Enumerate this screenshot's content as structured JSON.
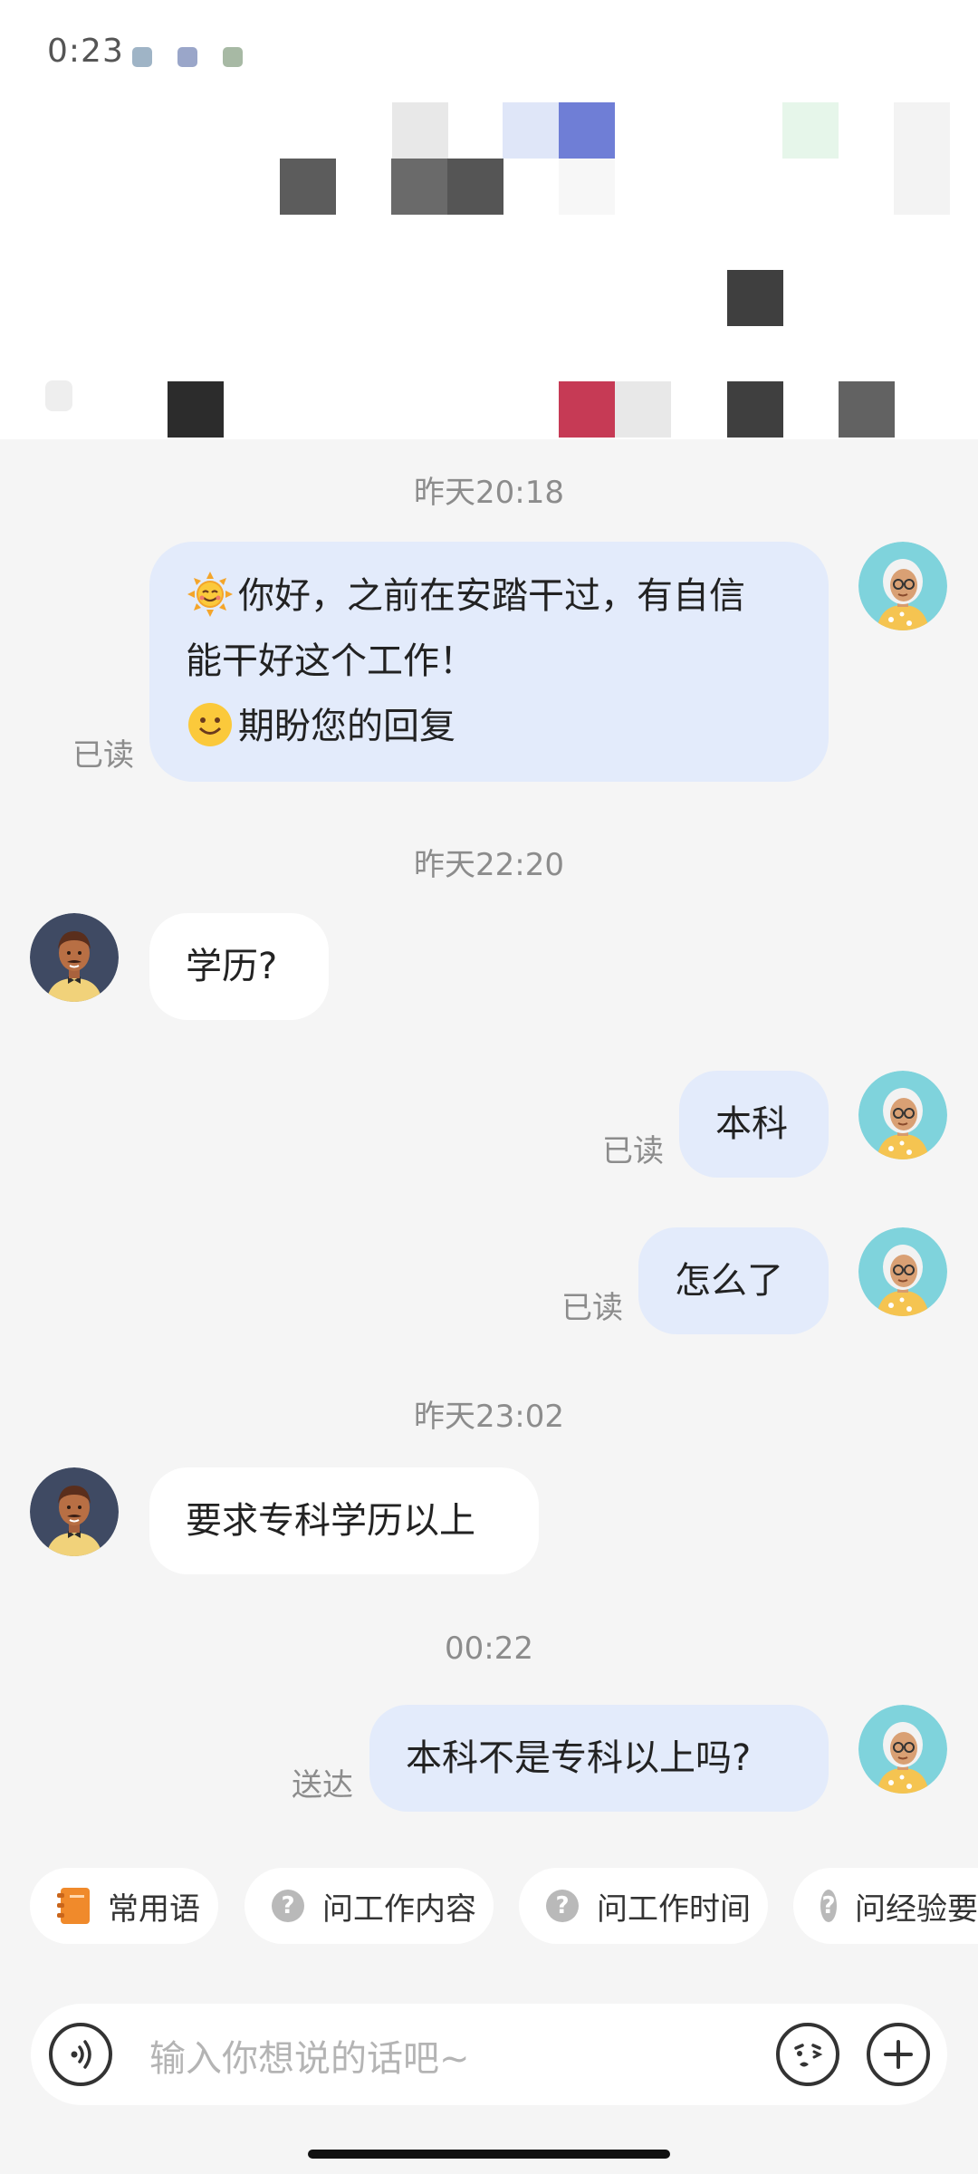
{
  "status_bar": {
    "time": "0:23"
  },
  "messages": [
    {
      "timestamp": "昨天20:18"
    },
    {
      "line1": "你好，之前在安踏干过，有自信",
      "line2": "能干好这个工作！",
      "line3": "期盼您的回复",
      "status": "已读"
    },
    {
      "timestamp": "昨天22:20"
    },
    {
      "text": "学历?"
    },
    {
      "text": "本科",
      "status": "已读"
    },
    {
      "text": "怎么了",
      "status": "已读"
    },
    {
      "timestamp": "昨天23:02"
    },
    {
      "text": "要求专科学历以上"
    },
    {
      "timestamp": "00:22"
    },
    {
      "text": "本科不是专科以上吗?",
      "status": "送达"
    }
  ],
  "quick_replies": [
    "常用语",
    "问工作内容",
    "问工作时间",
    "问经验要"
  ],
  "input": {
    "placeholder": "输入你想说的话吧~"
  },
  "icons": {
    "voice": "voice-icon",
    "emoji": "emoji-icon",
    "add": "plus-icon",
    "phrases": "notebook-icon",
    "question": "question-icon"
  },
  "colors": {
    "my_bubble": "#e3ebfb",
    "their_bubble": "#ffffff",
    "background": "#f5f5f5",
    "muted_text": "#8c8c8c"
  }
}
